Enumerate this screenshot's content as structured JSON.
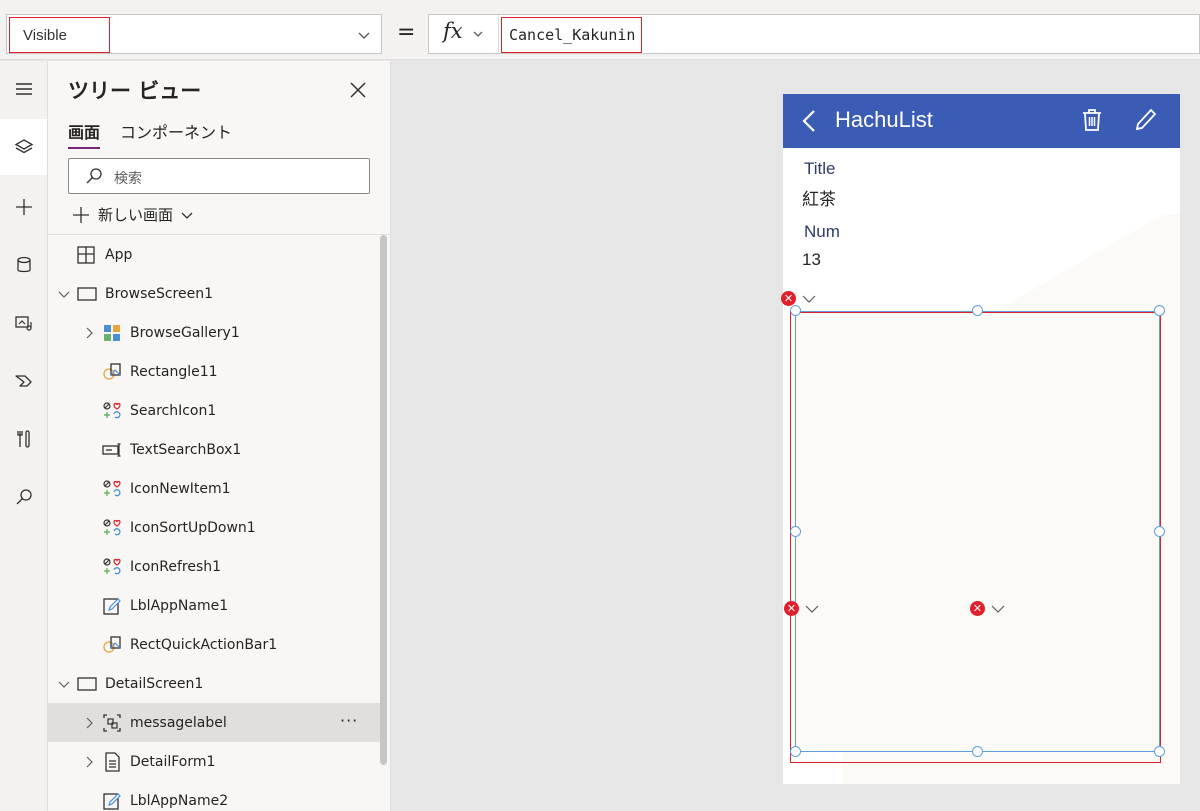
{
  "formula_bar": {
    "property": "Visible",
    "equals": "=",
    "fx_label": "fx",
    "formula": "Cancel_Kakunin"
  },
  "rail": {
    "items": [
      {
        "icon": "hamburger-icon"
      },
      {
        "icon": "layers-icon",
        "active": true
      },
      {
        "icon": "plus-icon"
      },
      {
        "icon": "database-icon"
      },
      {
        "icon": "media-icon"
      },
      {
        "icon": "power-automate-icon"
      },
      {
        "icon": "tools-icon"
      },
      {
        "icon": "search-icon"
      }
    ]
  },
  "tree": {
    "title": "ツリー ビュー",
    "tabs": [
      {
        "label": "画面",
        "active": true
      },
      {
        "label": "コンポーネント",
        "active": false
      }
    ],
    "search_placeholder": "検索",
    "new_screen_label": "新しい画面",
    "rows": [
      {
        "label": "App",
        "icon": "app-icon",
        "level": 0,
        "expand": "none"
      },
      {
        "label": "BrowseScreen1",
        "icon": "screen-icon",
        "level": 0,
        "expand": "expanded"
      },
      {
        "label": "BrowseGallery1",
        "icon": "gallery-icon",
        "level": 1,
        "expand": "collapsed"
      },
      {
        "label": "Rectangle11",
        "icon": "shape-icon",
        "level": 1,
        "expand": "none"
      },
      {
        "label": "SearchIcon1",
        "icon": "icons-control-icon",
        "level": 1,
        "expand": "none"
      },
      {
        "label": "TextSearchBox1",
        "icon": "textinput-icon",
        "level": 1,
        "expand": "none"
      },
      {
        "label": "IconNewItem1",
        "icon": "icons-control-icon",
        "level": 1,
        "expand": "none"
      },
      {
        "label": "IconSortUpDown1",
        "icon": "icons-control-icon",
        "level": 1,
        "expand": "none"
      },
      {
        "label": "IconRefresh1",
        "icon": "icons-control-icon",
        "level": 1,
        "expand": "none"
      },
      {
        "label": "LblAppName1",
        "icon": "label-icon",
        "level": 1,
        "expand": "none"
      },
      {
        "label": "RectQuickActionBar1",
        "icon": "shape-icon",
        "level": 1,
        "expand": "none"
      },
      {
        "label": "DetailScreen1",
        "icon": "screen-icon",
        "level": 0,
        "expand": "expanded"
      },
      {
        "label": "messagelabel",
        "icon": "group-icon",
        "level": 1,
        "expand": "collapsed",
        "selected": true,
        "more": "···"
      },
      {
        "label": "DetailForm1",
        "icon": "form-icon",
        "level": 1,
        "expand": "collapsed"
      },
      {
        "label": "LblAppName2",
        "icon": "label-icon",
        "level": 1,
        "expand": "none"
      }
    ]
  },
  "app_screen": {
    "header_title": "HachuList",
    "fields": [
      {
        "label": "Title",
        "value": "紅茶"
      },
      {
        "label": "Num",
        "value": "13"
      }
    ],
    "colors": {
      "header": "#3a5cb5",
      "selection": "#e0202a",
      "handles": "#5fa0dc"
    }
  }
}
